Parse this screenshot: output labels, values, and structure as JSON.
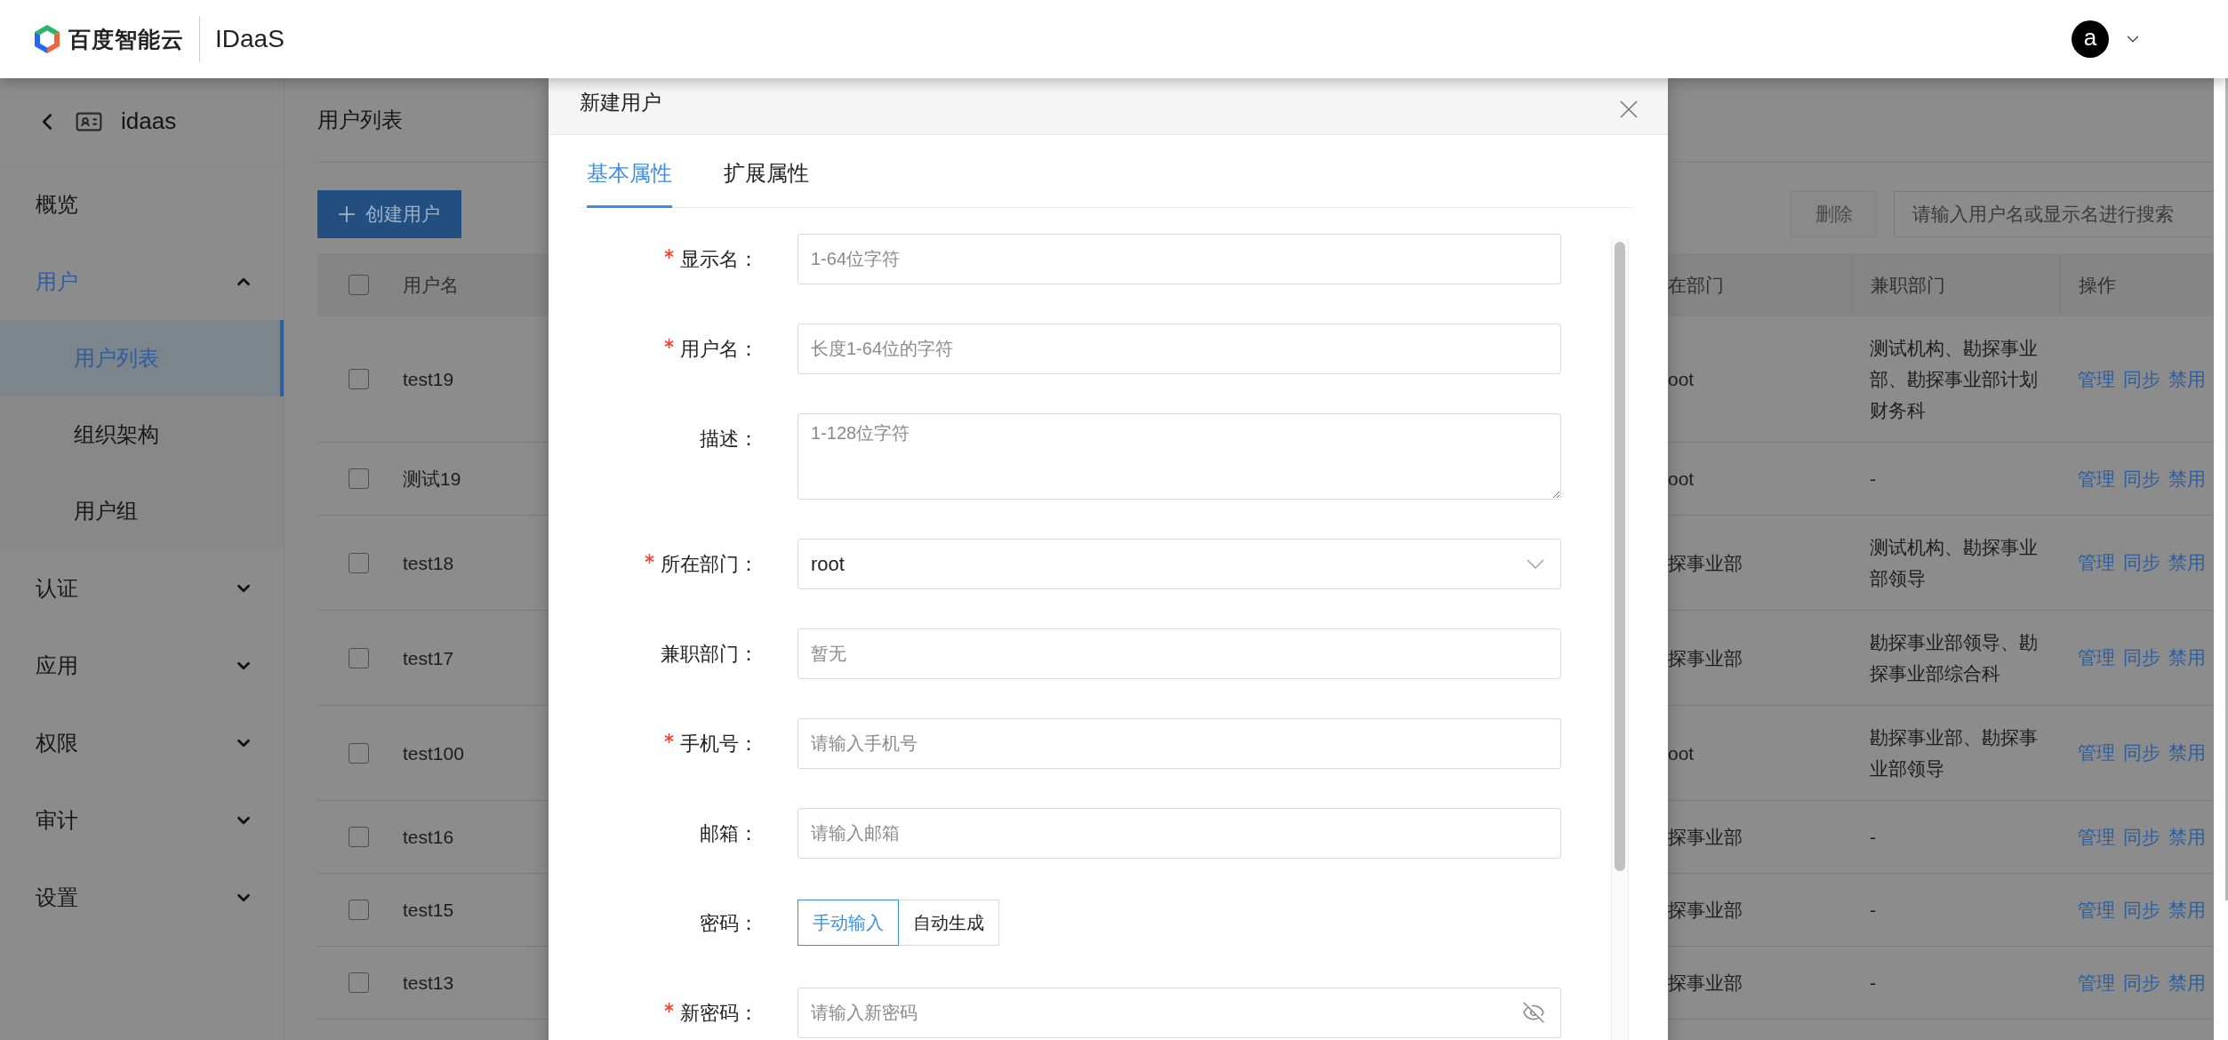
{
  "header": {
    "brand": "百度智能云",
    "product": "IDaaS",
    "avatar": "a"
  },
  "sidebar": {
    "back_title": "idaas",
    "items": [
      {
        "label": "概览",
        "kind": "link",
        "selected": false
      },
      {
        "label": "用户",
        "kind": "group",
        "expanded": true,
        "selected": true,
        "children": [
          {
            "label": "用户列表",
            "selected": true
          },
          {
            "label": "组织架构",
            "selected": false
          },
          {
            "label": "用户组",
            "selected": false
          }
        ]
      },
      {
        "label": "认证",
        "kind": "group",
        "expanded": false,
        "selected": false
      },
      {
        "label": "应用",
        "kind": "group",
        "expanded": false,
        "selected": false
      },
      {
        "label": "权限",
        "kind": "group",
        "expanded": false,
        "selected": false
      },
      {
        "label": "审计",
        "kind": "group",
        "expanded": false,
        "selected": false
      },
      {
        "label": "设置",
        "kind": "group",
        "expanded": false,
        "selected": false
      }
    ]
  },
  "page": {
    "title": "用户列表",
    "create_button": "创建用户",
    "delete_button": "删除",
    "delete_disabled": true,
    "search": {
      "placeholder": "请输入用户名或显示名进行搜索"
    }
  },
  "table": {
    "select_all_checked": false,
    "columns": [
      "用户名",
      "在部门",
      "兼职部门",
      "操作"
    ],
    "rows": [
      {
        "checked": false,
        "username": "test19",
        "department": "oot",
        "part_time": "测试机构、勘探事业部、勘探事业部计划财务科",
        "actions": [
          "管理",
          "同步",
          "禁用"
        ]
      },
      {
        "checked": false,
        "username": "测试19",
        "department": "oot",
        "part_time": "-",
        "actions": [
          "管理",
          "同步",
          "禁用"
        ]
      },
      {
        "checked": false,
        "username": "test18",
        "department": "探事业部",
        "part_time": "测试机构、勘探事业部领导",
        "actions": [
          "管理",
          "同步",
          "禁用"
        ]
      },
      {
        "checked": false,
        "username": "test17",
        "department": "探事业部",
        "part_time": "勘探事业部领导、勘探事业部综合科",
        "actions": [
          "管理",
          "同步",
          "禁用"
        ]
      },
      {
        "checked": false,
        "username": "test100",
        "department": "oot",
        "part_time": "勘探事业部、勘探事业部领导",
        "actions": [
          "管理",
          "同步",
          "禁用"
        ]
      },
      {
        "checked": false,
        "username": "test16",
        "department": "探事业部",
        "part_time": "-",
        "actions": [
          "管理",
          "同步",
          "禁用"
        ]
      },
      {
        "checked": false,
        "username": "test15",
        "department": "探事业部",
        "part_time": "-",
        "actions": [
          "管理",
          "同步",
          "禁用"
        ]
      },
      {
        "checked": false,
        "username": "test13",
        "department": "探事业部",
        "part_time": "-",
        "actions": [
          "管理",
          "同步",
          "禁用"
        ]
      }
    ]
  },
  "dialog": {
    "title": "新建用户",
    "tabs": [
      {
        "label": "基本属性",
        "selected": true
      },
      {
        "label": "扩展属性",
        "selected": false
      }
    ],
    "fields": [
      {
        "label": "显示名：",
        "required": true,
        "kind": "input",
        "placeholder": "1-64位字符"
      },
      {
        "label": "用户名：",
        "required": true,
        "kind": "input",
        "placeholder": "长度1-64位的字符"
      },
      {
        "label": "描述：",
        "required": false,
        "kind": "textarea",
        "placeholder": "1-128位字符"
      },
      {
        "label": "所在部门：",
        "required": true,
        "kind": "select",
        "value": "root"
      },
      {
        "label": "兼职部门：",
        "required": false,
        "kind": "input",
        "placeholder": "暂无"
      },
      {
        "label": "手机号：",
        "required": true,
        "kind": "input",
        "placeholder": "请输入手机号"
      },
      {
        "label": "邮箱：",
        "required": false,
        "kind": "input",
        "placeholder": "请输入邮箱"
      },
      {
        "label": "密码：",
        "required": false,
        "kind": "segmented",
        "options": [
          {
            "label": "手动输入",
            "selected": true
          },
          {
            "label": "自动生成",
            "selected": false
          }
        ]
      },
      {
        "label": "新密码：",
        "required": true,
        "kind": "password",
        "placeholder": "请输入新密码"
      }
    ]
  }
}
